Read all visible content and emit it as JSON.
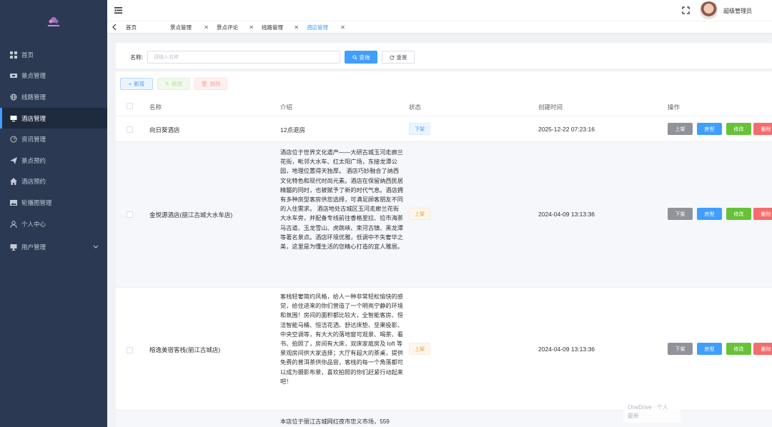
{
  "header": {
    "username": "超级管理员"
  },
  "sidebar": {
    "items": [
      {
        "label": "首页",
        "icon": "grid-icon"
      },
      {
        "label": "景点管理",
        "icon": "ticket-icon"
      },
      {
        "label": "线路管理",
        "icon": "globe-icon"
      },
      {
        "label": "酒店管理",
        "icon": "monitor-icon",
        "active": true
      },
      {
        "label": "资讯管理",
        "icon": "gauge-icon"
      },
      {
        "label": "景点预约",
        "icon": "send-icon"
      },
      {
        "label": "酒店预约",
        "icon": "home-icon"
      },
      {
        "label": "轮播图管理",
        "icon": "image-icon"
      },
      {
        "label": "个人中心",
        "icon": "user-icon"
      },
      {
        "label": "用户管理",
        "icon": "display-icon"
      }
    ]
  },
  "tabs": [
    {
      "label": "首页"
    },
    {
      "label": "景点管理"
    },
    {
      "label": "景点评论"
    },
    {
      "label": "线路管理"
    },
    {
      "label": "酒店管理",
      "active": true
    }
  ],
  "search": {
    "label": "名称:",
    "placeholder": "请输入名称",
    "query_label": "查询",
    "reset_label": "重置"
  },
  "toolbar": {
    "add_label": "新增",
    "edit_label": "修改",
    "delete_label": "删除"
  },
  "table": {
    "columns": [
      "名称",
      "介绍",
      "状态",
      "创建时间",
      "操作"
    ],
    "actions": {
      "toggle_up": "上架",
      "toggle_down": "下架",
      "room": "房型",
      "edit": "修改",
      "delete": "删除"
    },
    "rows": [
      {
        "name": "向日葵酒店",
        "intro": "12点退房",
        "status": "下架",
        "created": "2025-12-22 07:23:16",
        "toggle": "上架"
      },
      {
        "name": "金悦源酒店(丽江古城大水车店)",
        "intro": "酒店位于世界文化遗产——大研古城玉河走廊兰花街，毗邻大水车、红太阳广场，东接龙潭公园，地理位置得天独厚。 酒店巧妙融合了纳西文化特色和现代时尚元素。酒店在保留纳西民居精髓的同时，也被赋予了新的时代气息。酒店拥有多种房型客房供您选择，可满足顾客朋友不同的入住需求。 酒店地处古城区玉河走廊兰花街大水车旁，并配备专线前往香格里拉、拉市海茶马古道、玉龙雪山、虎跳峡、束河古镇、黑龙潭等著名景点。酒店环境优雅，低调中不失奢华之美，这里是为懂生活的您精心打造的宜人雅居。",
        "status": "上架",
        "created": "2024-04-09 13:13:36",
        "toggle": "下架"
      },
      {
        "name": "榕逸美宿客栈(丽江古城店)",
        "intro": "客栈轻奢简约风格，给人一种非常轻松愉快的感觉，给住进来的你们营造了一个明亮宁静的环境和氛围！房间的面积都比较大，全智能客房、恒洁智能马桶、恒洁花洒、舒达床垫、坚果投影、中央空调等，有大大的落地窗可观景、喝茶、看书、拍照了，房间有大床，双床家庭房及 loft 等景观房间供大家选择；大厅有超大的茶桌，提供免费的普洱茶供你品尝，客栈的每一个角落都可以成为摄影布景，喜欢拍照的你们赶紧行动起来吧！",
        "status": "上架",
        "created": "2024-04-09 13:13:36",
        "toggle": "下架"
      },
      {
        "name": "",
        "intro": "本店位于丽江古城网红夜市忠义市场，559",
        "status": "",
        "created": "",
        "toggle": ""
      }
    ]
  },
  "toast": {
    "line1": "OneDrive · 个人",
    "line2": "最新"
  }
}
